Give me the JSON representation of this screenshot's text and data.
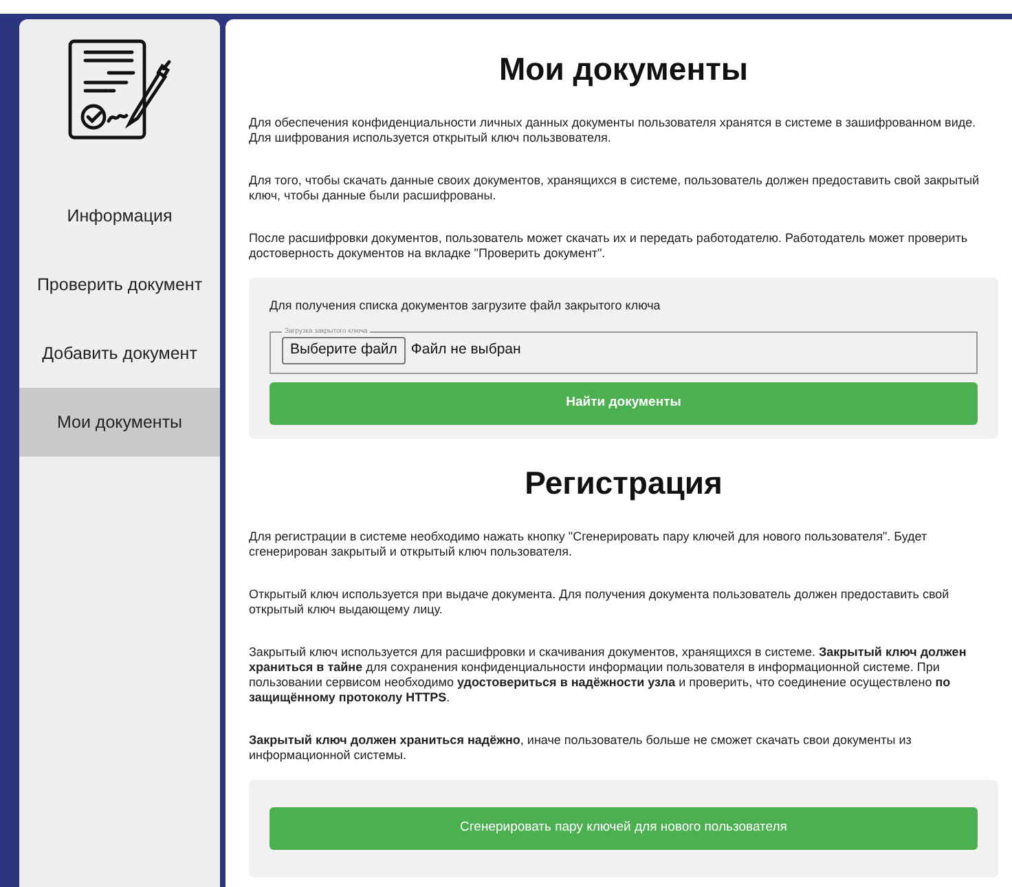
{
  "sidebar": {
    "items": [
      {
        "label": "Информация",
        "selected": false
      },
      {
        "label": "Проверить документ",
        "selected": false
      },
      {
        "label": "Добавить документ",
        "selected": false
      },
      {
        "label": "Мои документы",
        "selected": true
      }
    ]
  },
  "documents": {
    "title": "Мои документы",
    "paragraphs": [
      "Для обеспечения конфиденциальности личных данных документы пользователя хранятся в системе в зашифрованном виде. Для шифрования используется открытый ключ пользвователя.",
      "Для того, чтобы скачать данные своих документов, хранящихся в системе, пользователь должен предоставить свой закрытый ключ, чтобы данные были расшифрованы.",
      "После расшифровки документов, пользователь может скачать их и передать работодателю. Работодатель может проверить достоверность документов на вкладке \"Проверить документ\"."
    ],
    "panel": {
      "prompt": "Для получения списка документов загрузите файл закрытого ключа",
      "upload_legend": "Загрузка закрытого ключа",
      "file_button": "Выберите файл",
      "file_status": "Файл не выбран",
      "submit": "Найти документы"
    }
  },
  "registration": {
    "title": "Регистрация",
    "paragraphs": [
      "Для регистрации в системе необходимо нажать кнопку \"Сгенерировать пару ключей для нового пользователя\". Будет сгенерирован закрытый и открытый ключ пользователя.",
      "Открытый ключ используется при выдаче документа. Для получения документа пользователь должен предоставить свой открытый ключ выдающему лицу.",
      "Закрытый ключ используется для расшифровки и скачивания документов, хранящихся в системе. **Закрытый ключ должен храниться в тайне** для сохранения конфиденциальности информации пользователя в информационной системе. При пользовании сервисом необходимо **удостовериться в надёжности узла** и проверить, что соединение осуществлено **по защищённому протоколу HTTPS**.",
      "**Закрытый ключ должен храниться надёжно**, иначе пользователь больше не сможет скачать свои документы из информационной системы."
    ],
    "panel": {
      "submit": "Сгенерировать пару ключей для нового пользователя"
    }
  }
}
